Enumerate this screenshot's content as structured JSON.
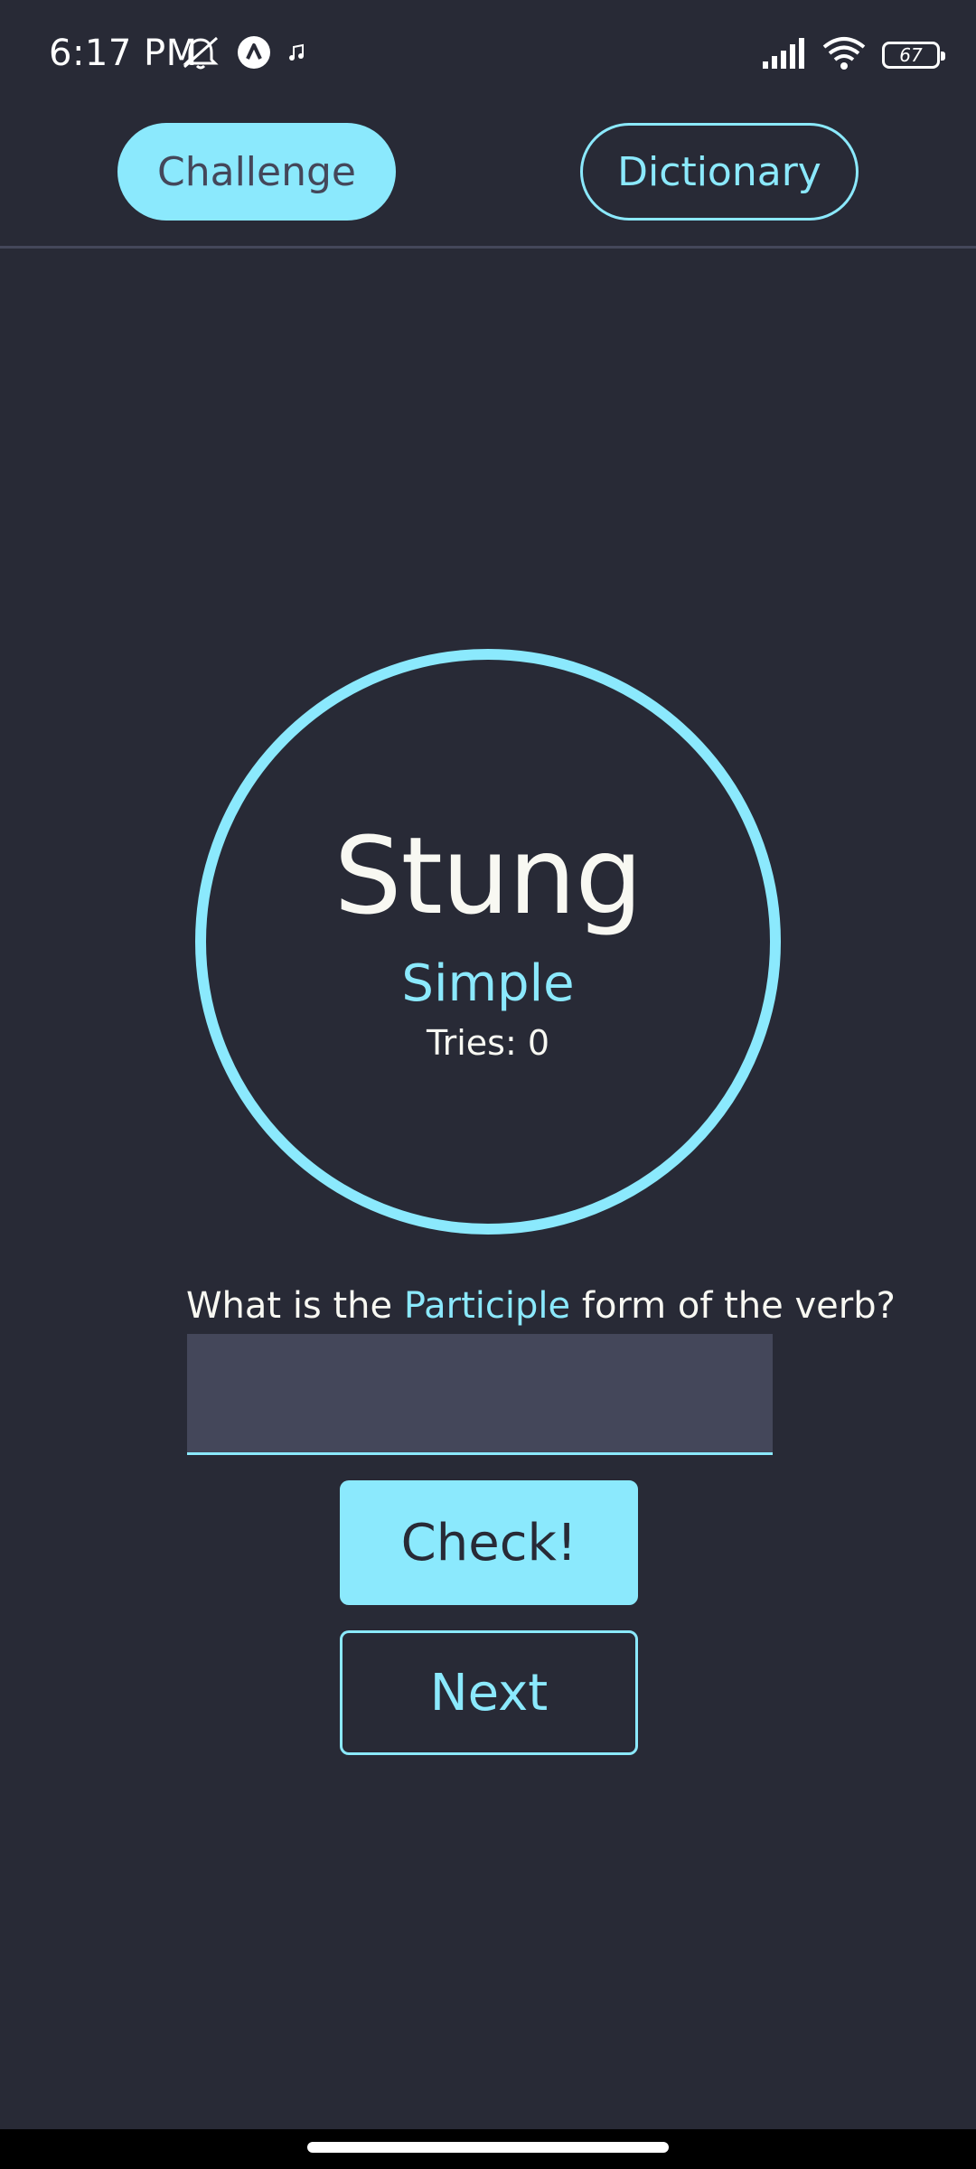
{
  "status_bar": {
    "time": "6:17 PM",
    "battery_level": "67",
    "icons": [
      "mute-alarm-icon",
      "app-notification-icon",
      "music-note-icon",
      "signal-icon",
      "wifi-icon",
      "battery-icon"
    ]
  },
  "tabs": {
    "challenge_label": "Challenge",
    "dictionary_label": "Dictionary",
    "active": "Challenge"
  },
  "challenge": {
    "word": "Stung",
    "tense": "Simple",
    "tries_label": "Tries: 0"
  },
  "question": {
    "prefix": "What is the ",
    "form": "Participle",
    "suffix": " form of the verb?"
  },
  "answer_input": {
    "value": "",
    "placeholder": ""
  },
  "buttons": {
    "check_label": "Check!",
    "next_label": "Next"
  },
  "colors": {
    "background": "#282a36",
    "accent": "#8be9fd",
    "input_bg": "#44475a",
    "text": "#f8f8f2"
  }
}
